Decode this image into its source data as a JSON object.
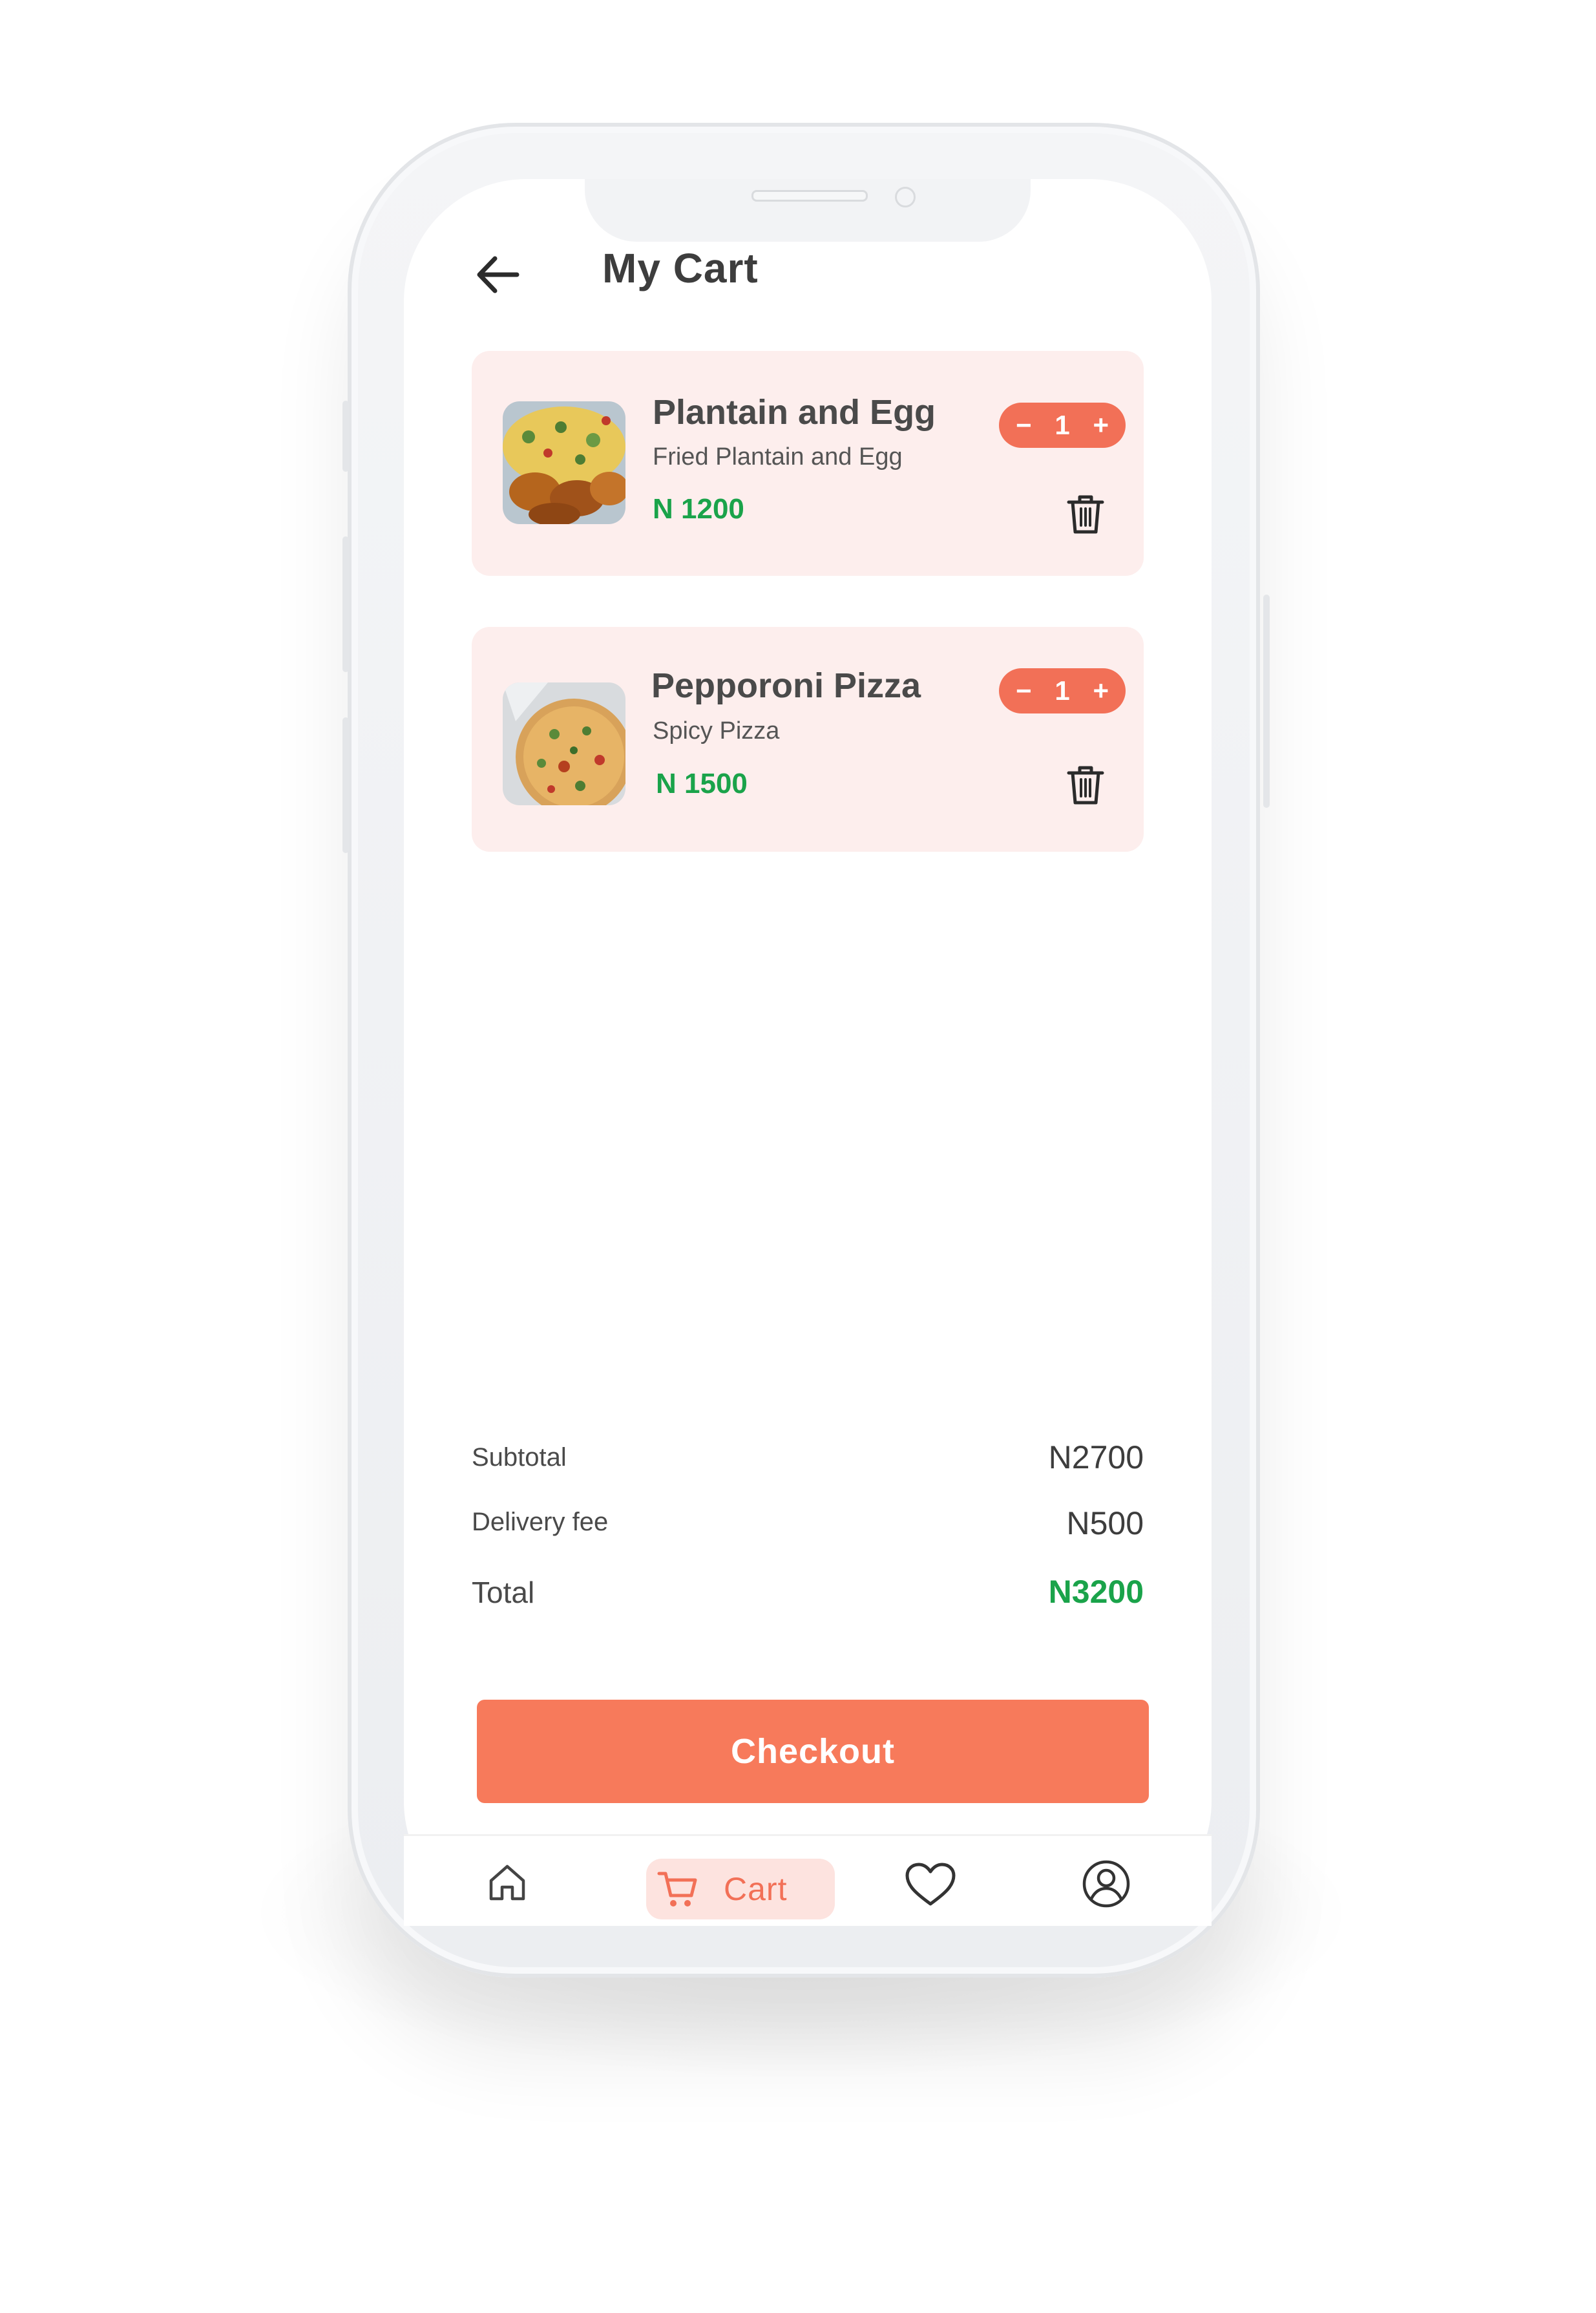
{
  "header": {
    "title": "My Cart",
    "back_icon": "arrow-left-icon"
  },
  "cart_items": [
    {
      "name": "Plantain and Egg",
      "description": "Fried Plantain and Egg",
      "price": "N 1200",
      "quantity": "1",
      "minus": "−",
      "plus": "+",
      "image": "plantain-and-egg-photo"
    },
    {
      "name": "Pepporoni Pizza",
      "description": "Spicy Pizza",
      "price": "N 1500",
      "quantity": "1",
      "minus": "−",
      "plus": "+",
      "image": "pepperoni-pizza-photo"
    }
  ],
  "summary": {
    "subtotal_label": "Subtotal",
    "subtotal_value": "N2700",
    "delivery_label": "Delivery fee",
    "delivery_value": "N500",
    "total_label": "Total",
    "total_value": "N3200"
  },
  "checkout_label": "Checkout",
  "bottom_nav": {
    "home_icon": "home-icon",
    "cart_label": "Cart",
    "cart_icon": "cart-icon",
    "favorites_icon": "heart-icon",
    "profile_icon": "user-circle-icon"
  },
  "colors": {
    "accent": "#F27057",
    "card_bg": "#FDEEED",
    "price_green": "#1AA34A",
    "checkout_bg": "#F77A5B"
  }
}
